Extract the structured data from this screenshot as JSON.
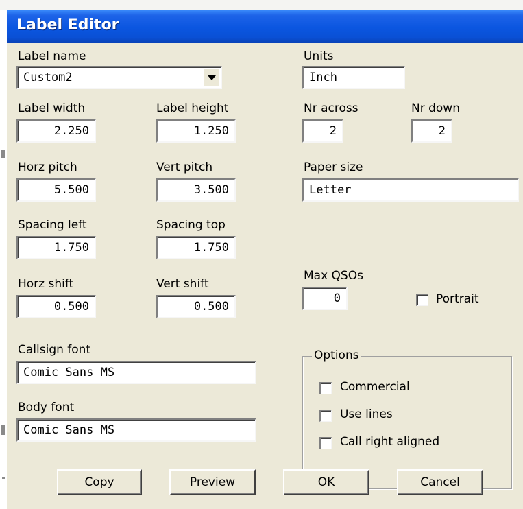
{
  "window": {
    "title": "Label Editor"
  },
  "label_name": {
    "label": "Label name",
    "value": "Custom2"
  },
  "units": {
    "label": "Units",
    "value": "Inch"
  },
  "label_width": {
    "label": "Label width",
    "value": "2.250"
  },
  "label_height": {
    "label": "Label height",
    "value": "1.250"
  },
  "nr_across": {
    "label": "Nr across",
    "value": "2"
  },
  "nr_down": {
    "label": "Nr down",
    "value": "2"
  },
  "horz_pitch": {
    "label": "Horz pitch",
    "value": "5.500"
  },
  "vert_pitch": {
    "label": "Vert pitch",
    "value": "3.500"
  },
  "paper_size": {
    "label": "Paper size",
    "value": "Letter"
  },
  "spacing_left": {
    "label": "Spacing left",
    "value": "1.750"
  },
  "spacing_top": {
    "label": "Spacing top",
    "value": "1.750"
  },
  "horz_shift": {
    "label": "Horz shift",
    "value": "0.500"
  },
  "vert_shift": {
    "label": "Vert shift",
    "value": "0.500"
  },
  "max_qsos": {
    "label": "Max QSOs",
    "value": "0"
  },
  "portrait": {
    "label": "Portrait",
    "checked": false
  },
  "callsign_font": {
    "label": "Callsign font",
    "value": "Comic Sans MS"
  },
  "body_font": {
    "label": "Body font",
    "value": "Comic Sans MS"
  },
  "options": {
    "title": "Options",
    "items": [
      {
        "label": "Commercial",
        "checked": false
      },
      {
        "label": "Use lines",
        "checked": false
      },
      {
        "label": "Call right aligned",
        "checked": false
      }
    ]
  },
  "buttons": {
    "copy": "Copy",
    "preview": "Preview",
    "ok": "OK",
    "cancel": "Cancel"
  },
  "colors": {
    "titlebar": "#0a50d5",
    "dialog_bg": "#ece9d8",
    "field_bg": "#ffffff"
  },
  "icons": {
    "combo_arrow": "chevron-down-icon"
  }
}
